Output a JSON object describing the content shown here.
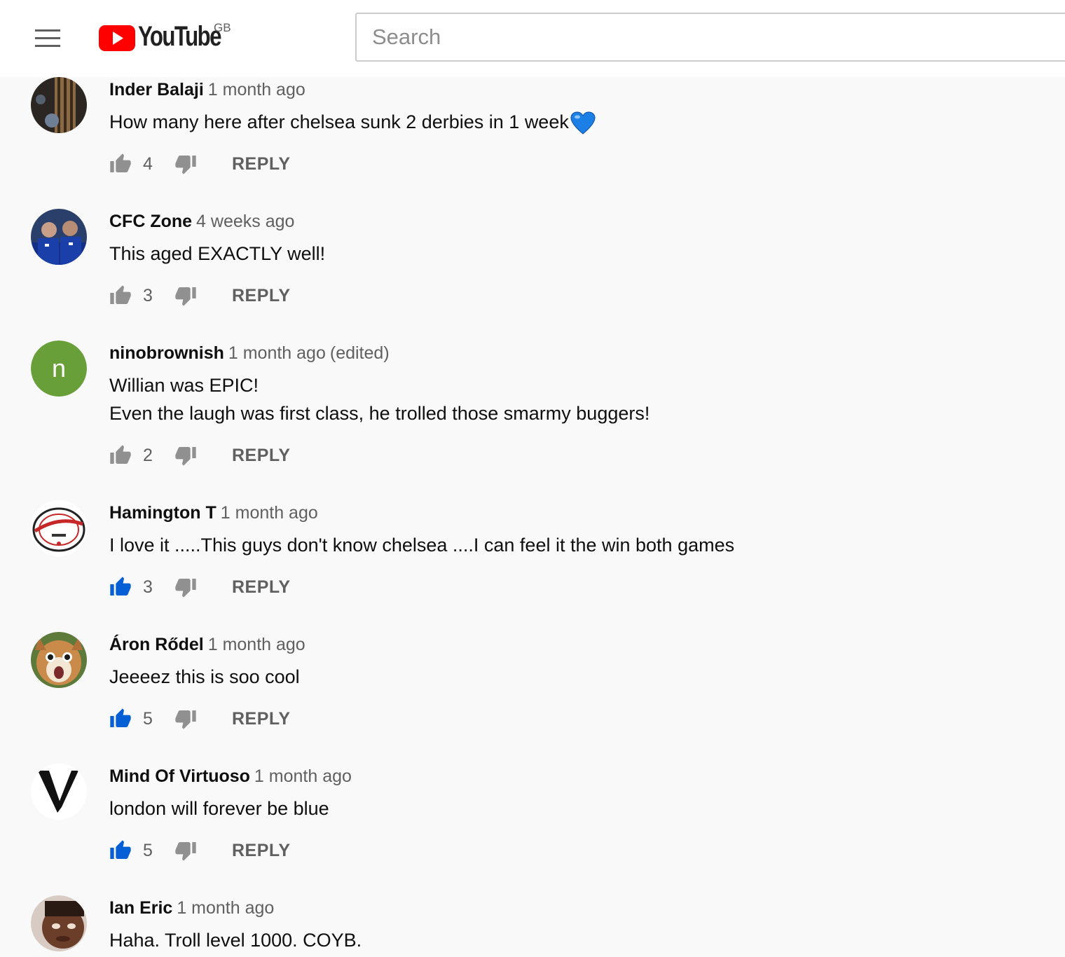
{
  "masthead": {
    "logo_text": "YouTube",
    "country_code": "GB",
    "search_placeholder": "Search"
  },
  "colors": {
    "brand_red": "#ff0000",
    "liked_blue": "#065fd4",
    "icon_gray": "#909090"
  },
  "comments": [
    {
      "author": "Inder Balaji",
      "time": "1 month ago",
      "edited": "",
      "lines": [
        "How many here after chelsea sunk 2 derbies in 1 week"
      ],
      "emoji": "blue-heart",
      "likes": "4",
      "liked": false,
      "reply_label": "REPLY"
    },
    {
      "author": "CFC Zone",
      "time": "4 weeks ago",
      "edited": "",
      "lines": [
        "This aged EXACTLY well!"
      ],
      "likes": "3",
      "liked": false,
      "reply_label": "REPLY"
    },
    {
      "author": "ninobrownish",
      "time": "1 month ago",
      "edited": "(edited)",
      "avatar_letter": "n",
      "avatar_color": "#689f38",
      "lines": [
        "Willian was EPIC!",
        "Even the laugh was first class, he trolled those smarmy buggers!"
      ],
      "likes": "2",
      "liked": false,
      "reply_label": "REPLY"
    },
    {
      "author": "Hamington T",
      "time": "1 month ago",
      "edited": "",
      "lines": [
        "I love it .....This guys don't know chelsea ....I can feel it the win both games"
      ],
      "likes": "3",
      "liked": true,
      "reply_label": "REPLY"
    },
    {
      "author": "Áron Rődel",
      "time": "1 month ago",
      "edited": "",
      "lines": [
        "Jeeeez this is soo cool"
      ],
      "likes": "5",
      "liked": true,
      "reply_label": "REPLY"
    },
    {
      "author": "Mind Of Virtuoso",
      "time": "1 month ago",
      "edited": "",
      "lines": [
        "london will forever be blue"
      ],
      "likes": "5",
      "liked": true,
      "reply_label": "REPLY"
    },
    {
      "author": "Ian Eric",
      "time": "1 month ago",
      "edited": "",
      "lines": [
        "Haha. Troll level 1000. COYB."
      ],
      "likes": "",
      "liked": false,
      "reply_label": ""
    }
  ]
}
